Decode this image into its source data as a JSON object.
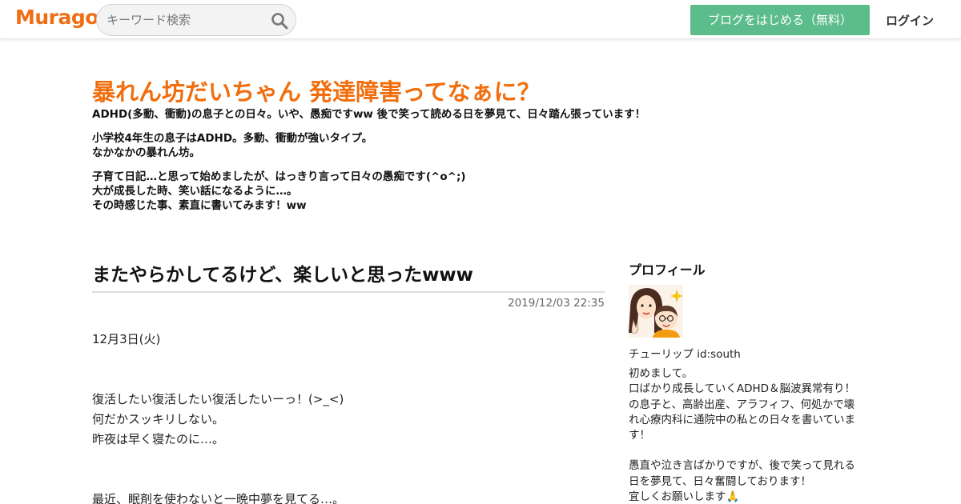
{
  "header": {
    "logo": "Muragon",
    "search": {
      "placeholder": "キーワード検索"
    },
    "start_button": "ブログをはじめる（無料）",
    "login": "ログイン",
    "accent_color": "#ef6d14",
    "button_color": "#5cbc8b"
  },
  "blog": {
    "title": "暴れん坊だいちゃん 発達障害ってなぁに？",
    "description": [
      [
        "ADHD(多動、衝動)の息子との日々。いや、愚痴ですww  後で笑って読める日を夢見て、日々踏ん張っています！"
      ],
      [
        "小学校4年生の息子はADHD。多動、衝動が強いタイプ。",
        "なかなかの暴れん坊。"
      ],
      [
        "子育て日記…と思って始めましたが、はっきり言って日々の愚痴です(^o^;)",
        "大が成長した時、笑い話になるように…。",
        "その時感じた事、素直に書いてみます！ww"
      ]
    ]
  },
  "post": {
    "title": "またやらかしてるけど、楽しいと思ったwww",
    "date": "2019/12/03 22:35",
    "body": [
      [
        "12月3日(火)"
      ],
      [
        "復活したい復活したい復活したいーっ！(>_<)",
        "何だかスッキリしない。",
        "昨夜は早く寝たのに…。"
      ],
      [
        "最近、眠剤を使わないと一晩中夢を見てる…。"
      ]
    ]
  },
  "sidebar": {
    "heading": "プロフィール",
    "name": "チューリップ   id:south",
    "bio": [
      [
        "初めまして。",
        "口ばかり成長していくADHD＆脳波異常有り！",
        "の息子と、高齢出産、アラフィフ、何処かで壊",
        "れ心療内科に通院中の私との日々を書いていま",
        "す！"
      ],
      [
        "愚直や泣き言ばかりですが、後で笑って見れる",
        "日を夢見て、日々奮闘しております！",
        "宜しくお願いします🙏"
      ]
    ]
  }
}
